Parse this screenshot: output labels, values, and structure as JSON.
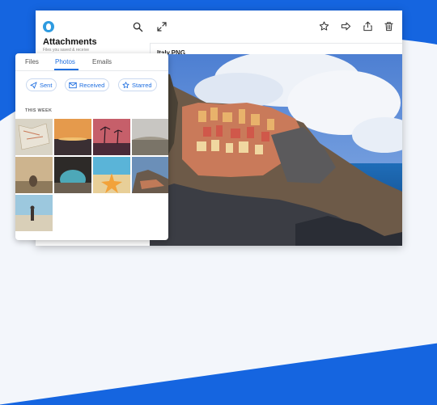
{
  "sidebar": {
    "title": "Attachments",
    "subtitle": "Files you saved & receive"
  },
  "viewer": {
    "file_name": "Italy.PNG"
  },
  "panel": {
    "tabs": [
      {
        "label": "Files",
        "active": false
      },
      {
        "label": "Photos",
        "active": true
      },
      {
        "label": "Emails",
        "active": false
      }
    ],
    "filters": [
      {
        "label": "Sent",
        "icon": "send-icon"
      },
      {
        "label": "Received",
        "icon": "mail-icon"
      },
      {
        "label": "Starred",
        "icon": "star-icon"
      }
    ],
    "section_label": "THIS WEEK"
  },
  "colors": {
    "brand_blue": "#1565e0",
    "accent": "#1f6fe0"
  }
}
